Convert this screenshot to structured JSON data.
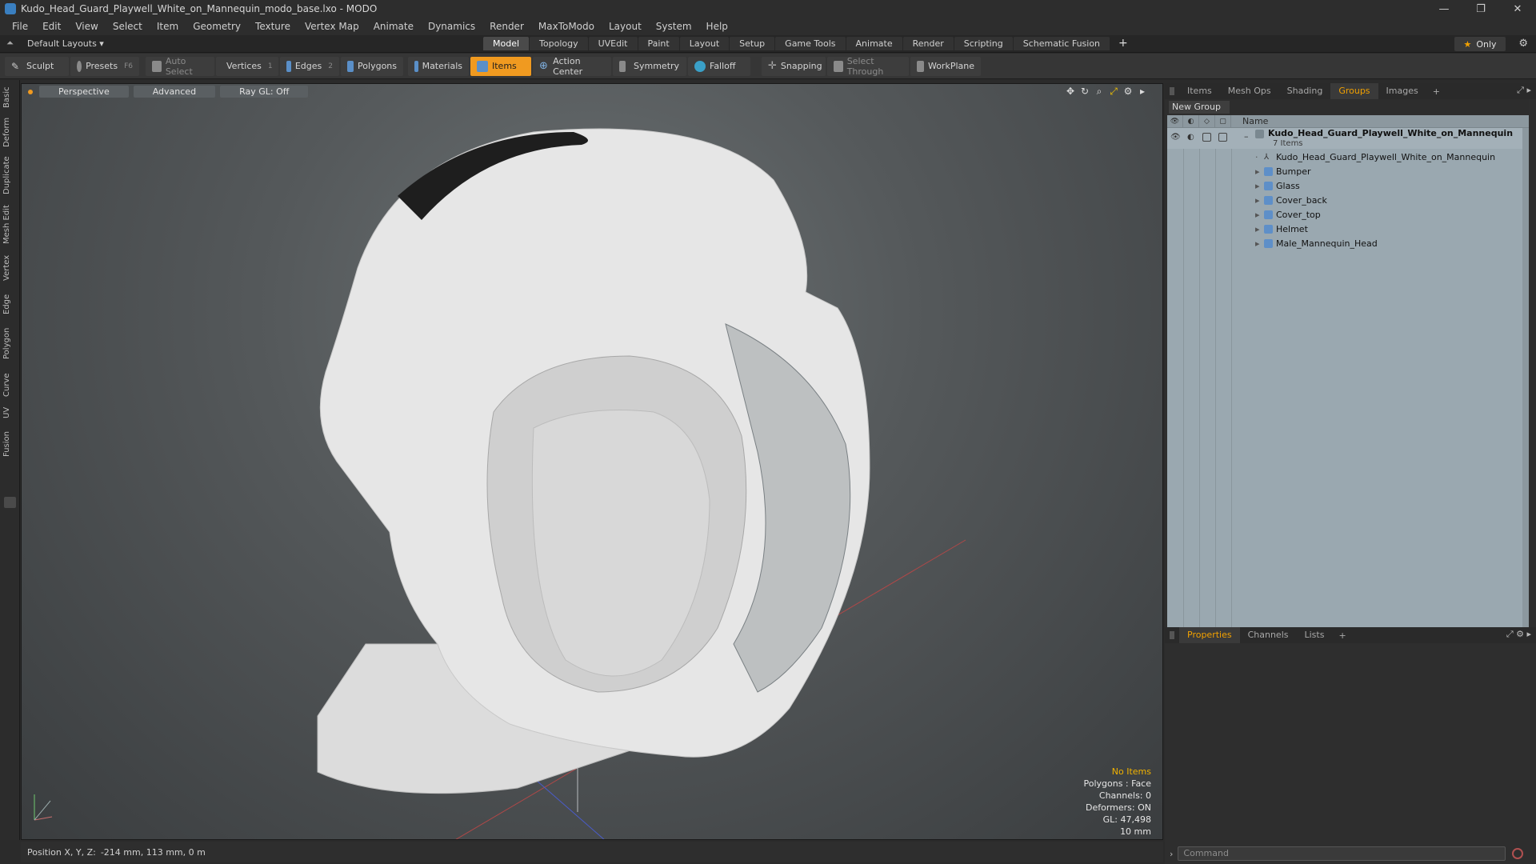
{
  "window": {
    "title": "Kudo_Head_Guard_Playwell_White_on_Mannequin_modo_base.lxo - MODO",
    "controls": [
      "—",
      "❐",
      "✕"
    ]
  },
  "menu": [
    "File",
    "Edit",
    "View",
    "Select",
    "Item",
    "Geometry",
    "Texture",
    "Vertex Map",
    "Animate",
    "Dynamics",
    "Render",
    "MaxToModo",
    "Layout",
    "System",
    "Help"
  ],
  "layout": {
    "preset": "Default Layouts ▾",
    "tabs": [
      "Model",
      "Topology",
      "UVEdit",
      "Paint",
      "Layout",
      "Setup",
      "Game Tools",
      "Animate",
      "Render",
      "Scripting",
      "Schematic Fusion"
    ],
    "active_tab": "Model",
    "plus": "+",
    "only": "Only"
  },
  "toolbar": {
    "sculpt": "Sculpt",
    "presets": "Presets",
    "presets_key": "F6",
    "auto_select": "Auto Select",
    "vertices": "Vertices",
    "vertices_key": "1",
    "edges": "Edges",
    "edges_key": "2",
    "polygons": "Polygons",
    "materials": "Materials",
    "items": "Items",
    "action_center": "Action Center",
    "symmetry": "Symmetry",
    "falloff": "Falloff",
    "snapping": "Snapping",
    "select_through": "Select Through",
    "workplane": "WorkPlane"
  },
  "left_tabs": [
    "Basic",
    "Deform",
    "Duplicate",
    "Mesh Edit",
    "Vertex",
    "Edge",
    "Polygon",
    "Curve",
    "UV",
    "Fusion"
  ],
  "viewport": {
    "view": "Perspective",
    "shading": "Advanced",
    "raygl": "Ray GL: Off",
    "hud": {
      "selection": "No Items",
      "polygons": "Polygons : Face",
      "channels": "Channels: 0",
      "deformers": "Deformers: ON",
      "gl": "GL: 47,498",
      "scale": "10 mm"
    },
    "position_label": "Position X, Y, Z:",
    "position_value": "-214 mm, 113 mm, 0 m"
  },
  "panel_top": {
    "tabs": [
      "Items",
      "Mesh Ops",
      "Shading",
      "Groups",
      "Images"
    ],
    "active_tab": "Groups",
    "new_group": "New Group",
    "column_name": "Name",
    "group": {
      "name": "Kudo_Head_Guard_Playwell_White_on_Mannequin",
      "count": "7 Items"
    },
    "items": [
      "Kudo_Head_Guard_Playwell_White_on_Mannequin",
      "Bumper",
      "Glass",
      "Cover_back",
      "Cover_top",
      "Helmet",
      "Male_Mannequin_Head"
    ]
  },
  "panel_bottom": {
    "tabs": [
      "Properties",
      "Channels",
      "Lists"
    ],
    "active_tab": "Properties",
    "command_placeholder": "Command"
  },
  "colors": {
    "accent": "#f09a20",
    "tree_bg": "#9aa8b0",
    "mesh_icon": "#5e8fc8"
  }
}
